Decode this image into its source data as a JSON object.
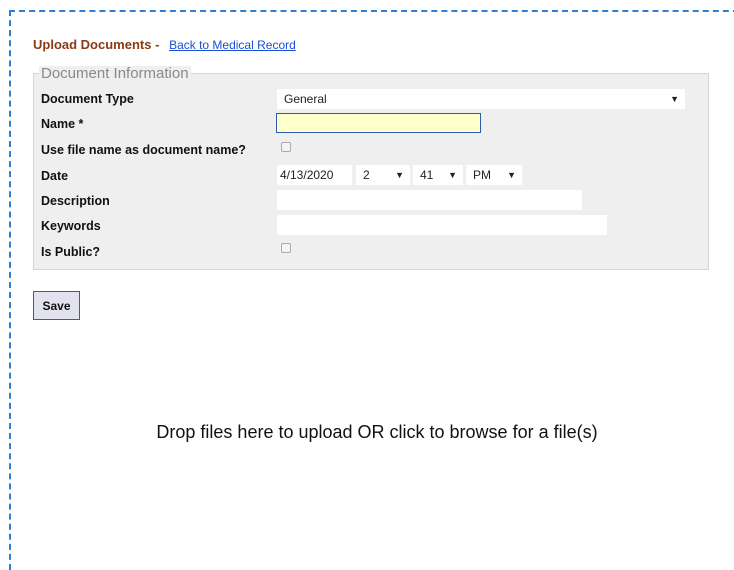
{
  "header": {
    "title": "Upload Documents",
    "separator": "-",
    "back_link": "Back to Medical Record"
  },
  "form": {
    "legend": "Document Information",
    "fields": {
      "document_type": {
        "label": "Document Type",
        "value": "General"
      },
      "name": {
        "label": "Name *",
        "value": ""
      },
      "use_file_name": {
        "label": "Use file name as document name?",
        "checked": false
      },
      "date": {
        "label": "Date",
        "value": "4/13/2020",
        "hour": "2",
        "minute": "41",
        "ampm": "PM"
      },
      "description": {
        "label": "Description",
        "value": ""
      },
      "keywords": {
        "label": "Keywords",
        "value": ""
      },
      "is_public": {
        "label": "Is Public?",
        "checked": false
      }
    }
  },
  "buttons": {
    "save": "Save"
  },
  "dropzone": {
    "text": "Drop files here to upload OR click to browse for a file(s)"
  },
  "icons": {
    "dropdown_arrow": "▼"
  },
  "colors": {
    "title": "#8b3a16",
    "link": "#1a4fd6",
    "dropzone_border": "#2f7fd1",
    "name_field_bg": "#ffffcc"
  }
}
